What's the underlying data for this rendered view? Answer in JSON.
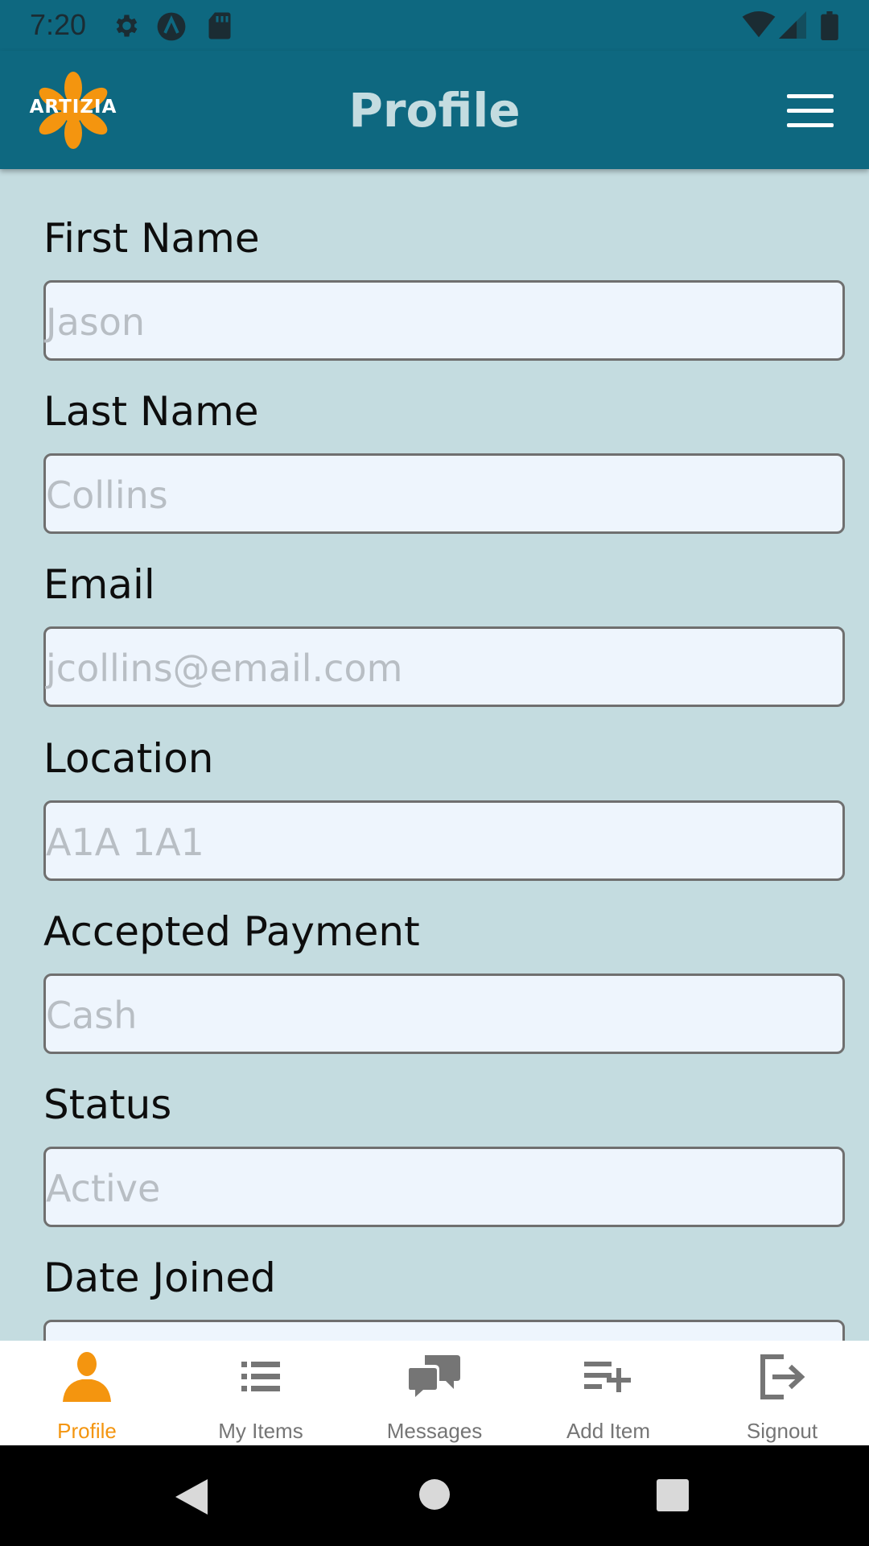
{
  "status_bar": {
    "time": "7:20",
    "left_icons": [
      "settings-icon",
      "a-logo-icon",
      "sd-card-icon"
    ],
    "right_icons": [
      "wifi-icon",
      "signal-icon",
      "battery-icon"
    ]
  },
  "app_bar": {
    "logo_text": "ARTIZIA",
    "title": "Profile",
    "menu_icon": "hamburger-menu-icon"
  },
  "form": {
    "fields": [
      {
        "label": "First Name",
        "placeholder": "Jason"
      },
      {
        "label": "Last Name",
        "placeholder": "Collins"
      },
      {
        "label": "Email",
        "placeholder": "jcollins@email.com"
      },
      {
        "label": "Location",
        "placeholder": "A1A 1A1"
      },
      {
        "label": "Accepted Payment",
        "placeholder": "Cash"
      },
      {
        "label": "Status",
        "placeholder": "Active"
      },
      {
        "label": "Date Joined",
        "placeholder": ""
      }
    ]
  },
  "bottom_nav": {
    "items": [
      {
        "label": "Profile",
        "icon": "person-icon",
        "active": true
      },
      {
        "label": "My Items",
        "icon": "list-icon",
        "active": false
      },
      {
        "label": "Messages",
        "icon": "chat-icon",
        "active": false
      },
      {
        "label": "Add Item",
        "icon": "playlist-add-icon",
        "active": false
      },
      {
        "label": "Signout",
        "icon": "logout-icon",
        "active": false
      }
    ]
  },
  "system_nav": [
    "back-icon",
    "home-icon",
    "recents-icon"
  ],
  "colors": {
    "app_bar": "#0e6880",
    "background": "#c4dce0",
    "accent": "#f4950f",
    "input_bg": "#eef5fd",
    "title_text": "#c4dce0"
  }
}
